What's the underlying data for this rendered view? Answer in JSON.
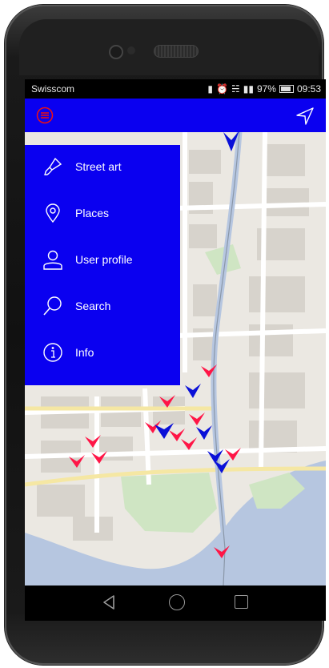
{
  "status_bar": {
    "carrier": "Swisscom",
    "battery": "97%",
    "time": "09:53"
  },
  "app_bar": {
    "menu_icon": "hamburger-menu-icon",
    "navigation_icon": "navigation-arrow-icon",
    "color": "#0a00f0"
  },
  "drawer": {
    "items": [
      {
        "label": "Street art",
        "icon": "paintbrush-icon"
      },
      {
        "label": "Places",
        "icon": "location-pin-icon"
      },
      {
        "label": "User profile",
        "icon": "user-icon"
      },
      {
        "label": "Search",
        "icon": "search-icon"
      },
      {
        "label": "Info",
        "icon": "info-icon"
      }
    ]
  },
  "map": {
    "marker_colors": {
      "red": "#ff1546",
      "blue": "#0a10d8"
    }
  },
  "nav_bar": {
    "icons": [
      "back-icon",
      "home-icon",
      "recent-apps-icon"
    ]
  }
}
